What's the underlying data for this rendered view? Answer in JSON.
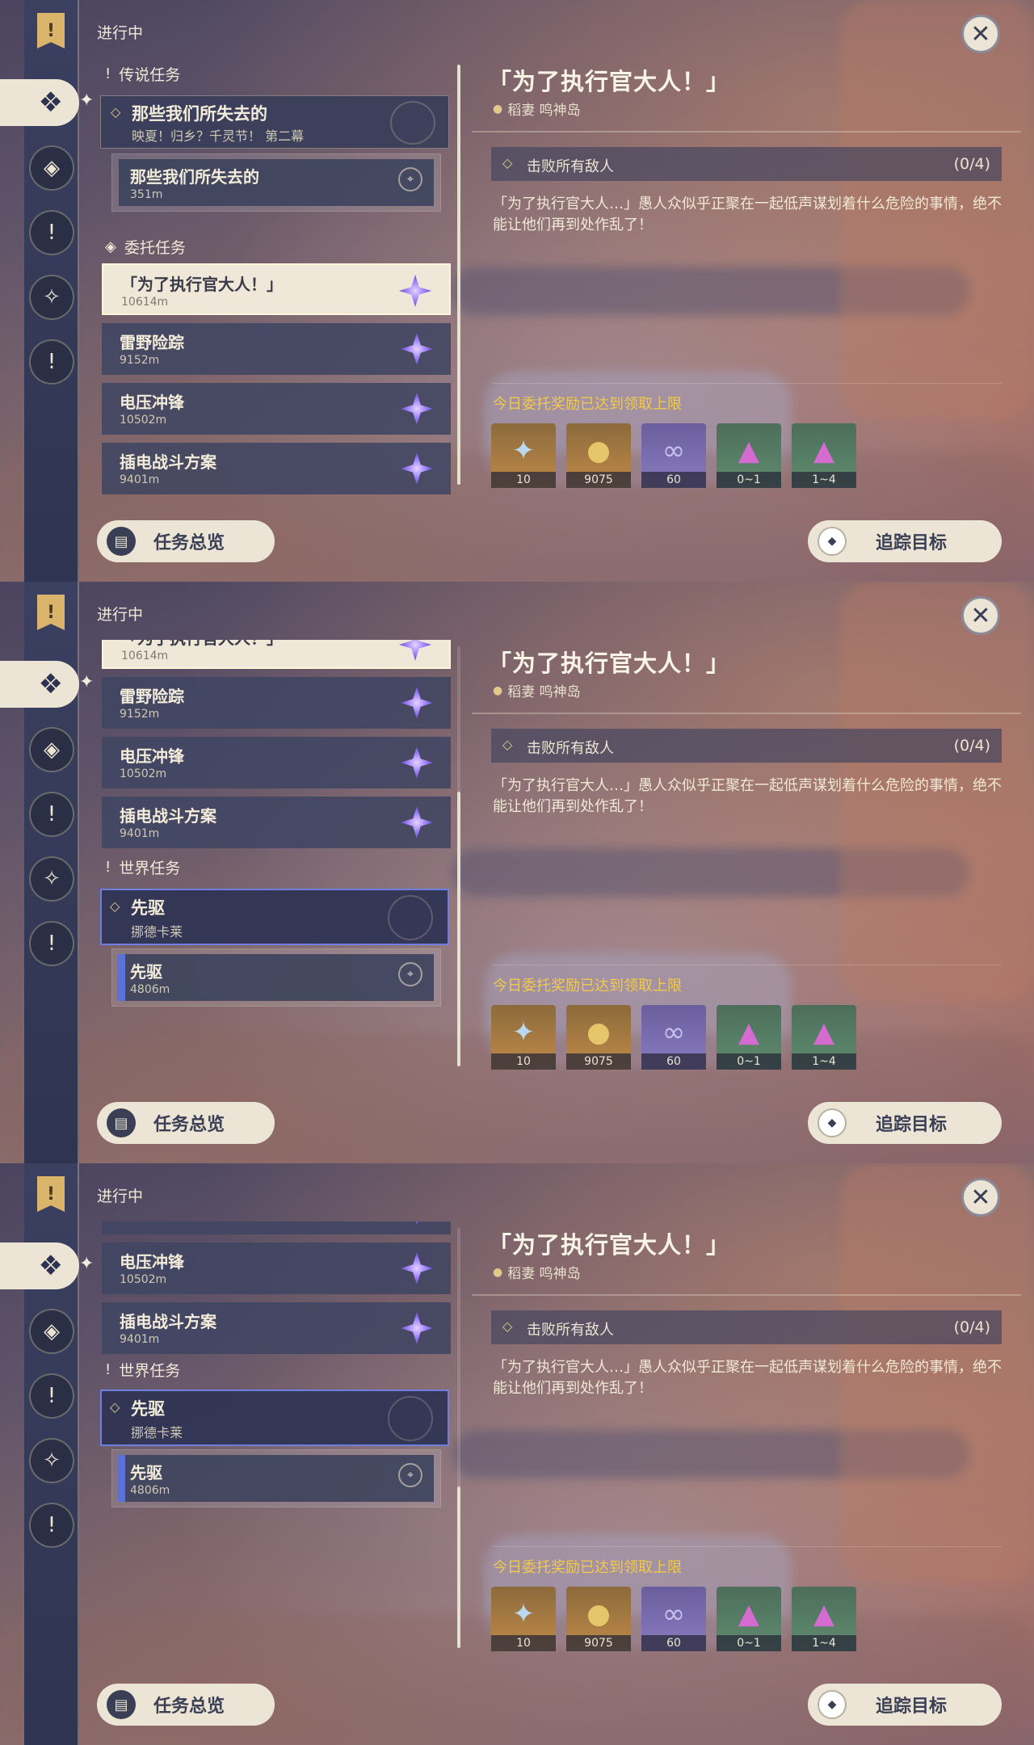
{
  "ui": {
    "status_label": "进行中",
    "close_glyph": "✕",
    "overview_label": "任务总览",
    "track_label": "追踪目标"
  },
  "rail": {
    "icons": [
      "bookmark-icon",
      "archon-quest-icon",
      "story-quest-icon",
      "world-quest-icon",
      "commission-icon",
      "exclamation-icon"
    ]
  },
  "categories": {
    "legend": "传说任务",
    "commission": "委托任务",
    "world": "世界任务"
  },
  "quests": {
    "legend_main": {
      "title": "那些我们所失去的",
      "subtitle": "映夏！归乡？千灵节！ 第二幕"
    },
    "legend_sub": {
      "title": "那些我们所失去的",
      "distance": "351m"
    },
    "commissions": [
      {
        "title": "「为了执行官大人！」",
        "distance": "10614m"
      },
      {
        "title": "雷野险踪",
        "distance": "9152m"
      },
      {
        "title": "电压冲锋",
        "distance": "10502m"
      },
      {
        "title": "插电战斗方案",
        "distance": "9401m"
      }
    ],
    "world_main": {
      "title": "先驱",
      "subtitle": "挪德卡莱"
    },
    "world_sub": {
      "title": "先驱",
      "distance": "4806m"
    }
  },
  "detail": {
    "title": "「为了执行官大人！」",
    "location": "稻妻 鸣神岛",
    "objective": "击败所有敌人",
    "objective_count": "(0/4)",
    "description": "「为了执行官大人…」愚人众似乎正聚在一起低声谋划着什么危险的事情，绝不能让他们再到处作乱了！",
    "reward_notice": "今日委托奖励已达到领取上限",
    "rewards": [
      {
        "icon": "adventure-exp-icon",
        "qty": "10"
      },
      {
        "icon": "mora-icon",
        "qty": "9075"
      },
      {
        "icon": "companionship-exp-icon",
        "qty": "60"
      },
      {
        "icon": "crystal-chunk-icon",
        "qty": "0~1"
      },
      {
        "icon": "crystal-cluster-icon",
        "qty": "1~4"
      }
    ]
  },
  "colors": {
    "accent_gold": "#f2c94c",
    "selected_bg": "#efe8d8",
    "world_blue": "#6e7fe0"
  }
}
